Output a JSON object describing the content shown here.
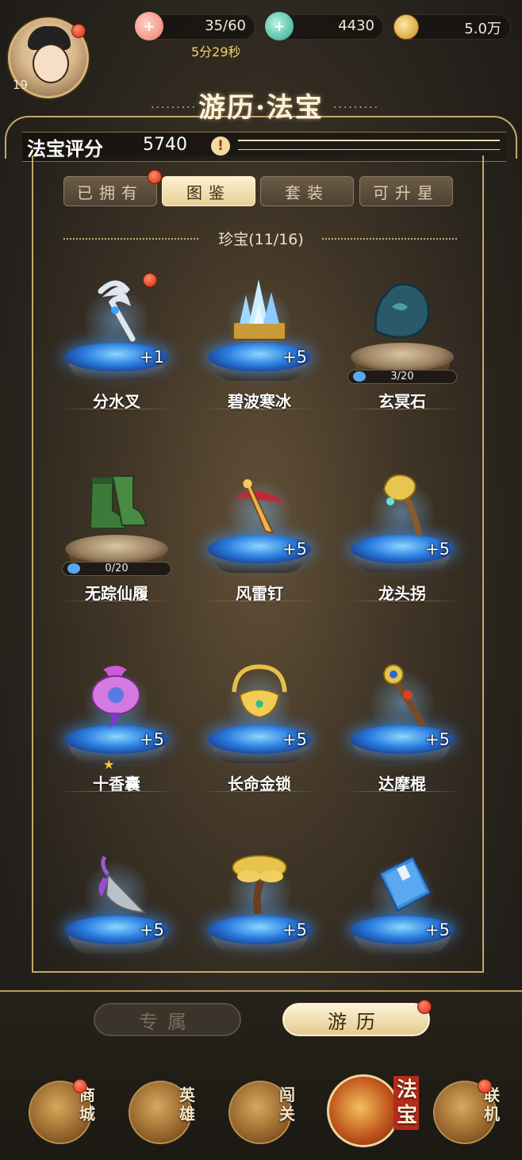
{
  "player": {
    "level": "19"
  },
  "resources": {
    "stamina": {
      "icon": "peach-plus-icon",
      "value": "35/60"
    },
    "timer": "5分29秒",
    "jade": {
      "icon": "jade-plus-icon",
      "value": "4430"
    },
    "coins": {
      "icon": "coin-icon",
      "value": "5.0万"
    }
  },
  "title": "游历·法宝",
  "score": {
    "label": "法宝评分",
    "value": "5740"
  },
  "tabs": [
    {
      "label": "已拥有",
      "active": false,
      "badge": true
    },
    {
      "label": "图鉴",
      "active": true,
      "badge": false
    },
    {
      "label": "套装",
      "active": false,
      "badge": false
    },
    {
      "label": "可升星",
      "active": false,
      "badge": false
    }
  ],
  "section": {
    "title": "珍宝(11/16)"
  },
  "items": [
    {
      "name": "分水叉",
      "plus": "+1",
      "icon": "trident-icon",
      "glow": true,
      "badge": true
    },
    {
      "name": "碧波寒冰",
      "plus": "+5",
      "icon": "ice-crystal-icon",
      "glow": true
    },
    {
      "name": "玄冥石",
      "progress": "3/20",
      "icon": "dark-stone-icon",
      "glow": false
    },
    {
      "name": "无踪仙履",
      "progress": "0/20",
      "icon": "boots-icon",
      "glow": false
    },
    {
      "name": "风雷钉",
      "plus": "+5",
      "icon": "thunder-nail-icon",
      "glow": true
    },
    {
      "name": "龙头拐",
      "plus": "+5",
      "icon": "dragon-staff-icon",
      "glow": true
    },
    {
      "name": "十香囊",
      "plus": "+5",
      "icon": "scent-pouch-icon",
      "glow": true,
      "star": true
    },
    {
      "name": "长命金锁",
      "plus": "+5",
      "icon": "golden-lock-icon",
      "glow": true
    },
    {
      "name": "达摩棍",
      "plus": "+5",
      "icon": "dharma-staff-icon",
      "glow": true
    },
    {
      "name": "",
      "plus": "+5",
      "icon": "spade-icon",
      "glow": true
    },
    {
      "name": "",
      "plus": "+5",
      "icon": "money-tree-icon",
      "glow": true
    },
    {
      "name": "",
      "plus": "+5",
      "icon": "scripture-book-icon",
      "glow": true
    }
  ],
  "subtabs": [
    {
      "label": "专属",
      "active": false
    },
    {
      "label": "游历",
      "active": true,
      "badge": true
    }
  ],
  "nav": [
    {
      "label": "商城",
      "icon": "shop-icon",
      "badge": true
    },
    {
      "label": "英雄",
      "icon": "hero-icon"
    },
    {
      "label": "闯关",
      "icon": "swords-icon"
    },
    {
      "label": "法宝",
      "icon": "treasure-gourd-icon",
      "active": true
    },
    {
      "label": "联机",
      "icon": "multiplayer-icon",
      "badge": true
    }
  ]
}
